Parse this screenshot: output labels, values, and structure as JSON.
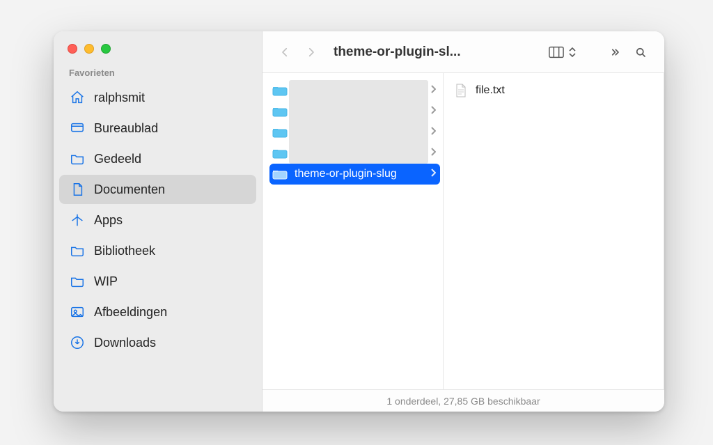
{
  "window_title": "theme-or-plugin-sl...",
  "sidebar": {
    "section_label": "Favorieten",
    "items": [
      {
        "icon": "home",
        "label": "ralphsmit",
        "selected": false
      },
      {
        "icon": "desktop",
        "label": "Bureaublad",
        "selected": false
      },
      {
        "icon": "folder",
        "label": "Gedeeld",
        "selected": false
      },
      {
        "icon": "document",
        "label": "Documenten",
        "selected": true
      },
      {
        "icon": "apps",
        "label": "Apps",
        "selected": false
      },
      {
        "icon": "folder",
        "label": "Bibliotheek",
        "selected": false
      },
      {
        "icon": "folder",
        "label": "WIP",
        "selected": false
      },
      {
        "icon": "photo",
        "label": "Afbeeldingen",
        "selected": false
      },
      {
        "icon": "download",
        "label": "Downloads",
        "selected": false
      }
    ]
  },
  "col1": {
    "items": [
      {
        "label": "",
        "dim": true
      },
      {
        "label": "",
        "dim": true
      },
      {
        "label": "",
        "dim": true
      },
      {
        "label": "",
        "dim": true
      },
      {
        "label": "theme-or-plugin-slug",
        "selected": true
      }
    ]
  },
  "col2": {
    "items": [
      {
        "label": "file.txt",
        "type": "file"
      }
    ]
  },
  "status": "1 onderdeel, 27,85 GB beschikbaar",
  "colors": {
    "accent": "#0a64ff",
    "folder": "#5ec6f2"
  }
}
